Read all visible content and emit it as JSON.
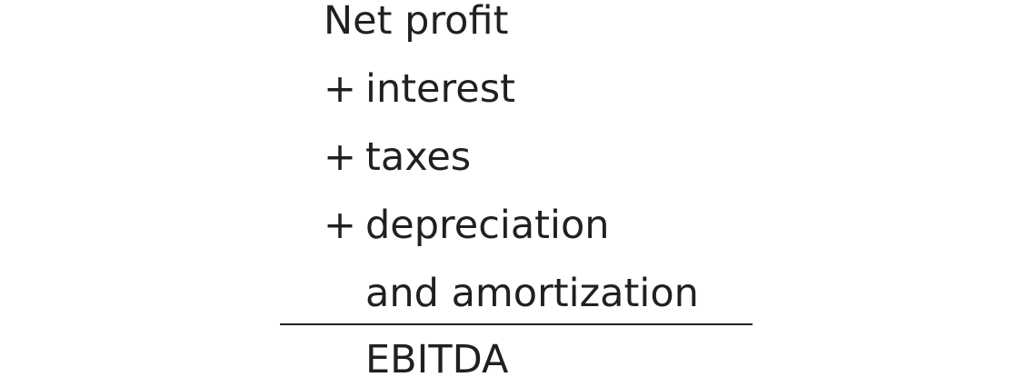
{
  "equation": {
    "first_line": "Net profit",
    "additions": [
      {
        "operator": "+",
        "label": "interest"
      },
      {
        "operator": "+",
        "label": "taxes"
      },
      {
        "operator": "+",
        "label": "depreciation"
      }
    ],
    "continuation": "and amortization",
    "result": "EBITDA"
  },
  "colors": {
    "text": "#231f20",
    "background": "#ffffff"
  }
}
